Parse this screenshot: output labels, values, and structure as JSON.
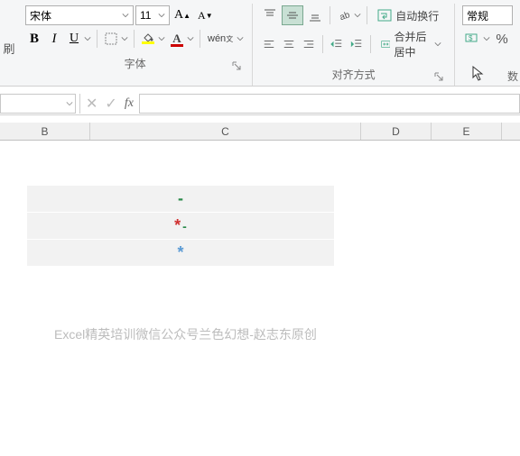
{
  "ribbon": {
    "refresh_label": "刷",
    "font": {
      "family": "宋体",
      "size": "11",
      "bold": "B",
      "italic": "I",
      "underline": "U",
      "inc_a": "A",
      "dec_a": "A",
      "wen": "wén",
      "group_label": "字体"
    },
    "align": {
      "wrap_label": "自动换行",
      "merge_label": "合并后居中",
      "group_label": "对齐方式"
    },
    "number": {
      "format": "常规",
      "percent": "%",
      "group_label": "数"
    }
  },
  "formula_bar": {
    "namebox": "",
    "cancel": "✕",
    "confirm": "✓",
    "fx": "fx",
    "value": ""
  },
  "columns": {
    "B": "B",
    "C": "C",
    "D": "D",
    "E": "E"
  },
  "cells": {
    "r1": "-",
    "r2_star": "*",
    "r2_dash": "-",
    "r3": "*"
  },
  "watermark": "Excel精英培训微信公众号兰色幻想-赵志东原创",
  "chart_data": null
}
